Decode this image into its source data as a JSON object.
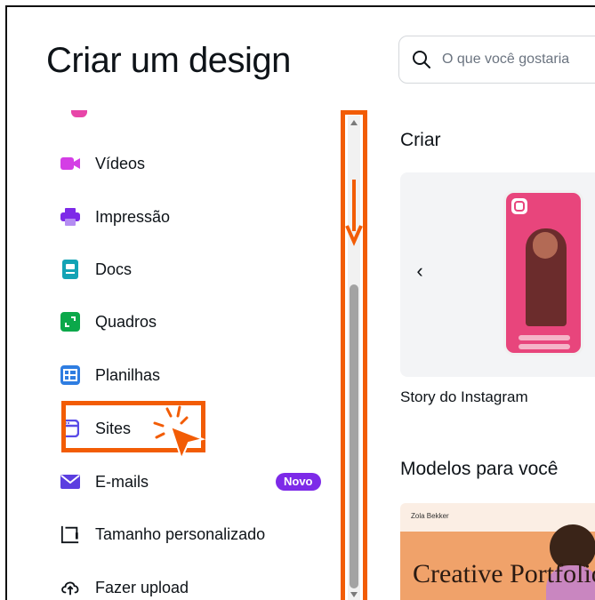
{
  "header": {
    "title": "Criar um design",
    "search_placeholder": "O que você gostaria"
  },
  "sidebar": {
    "items": [
      {
        "label": "Vídeos",
        "icon": "video-icon",
        "color": "#d43ee5"
      },
      {
        "label": "Impressão",
        "icon": "printer-icon",
        "color": "#7d2ae8"
      },
      {
        "label": "Docs",
        "icon": "doc-icon",
        "color": "#13a3b5"
      },
      {
        "label": "Quadros",
        "icon": "whiteboard-icon",
        "color": "#0ba84a"
      },
      {
        "label": "Planilhas",
        "icon": "spreadsheet-icon",
        "color": "#2f7de1"
      },
      {
        "label": "Sites",
        "icon": "website-icon",
        "color": "#5a4be7"
      },
      {
        "label": "E-mails",
        "icon": "email-icon",
        "color": "#5b3ee0",
        "badge": "Novo"
      },
      {
        "label": "Tamanho personalizado",
        "icon": "resize-icon",
        "color": "#0e1318"
      },
      {
        "label": "Fazer upload",
        "icon": "upload-icon",
        "color": "#0e1318"
      }
    ]
  },
  "main": {
    "create_heading": "Criar",
    "story_label": "Story do Instagram",
    "templates_heading": "Modelos para você",
    "template_brand": "Zola Bekker",
    "template_text": "Creative Portfolio"
  },
  "colors": {
    "highlight": "#f25c05",
    "badge": "#7d2ae8"
  }
}
